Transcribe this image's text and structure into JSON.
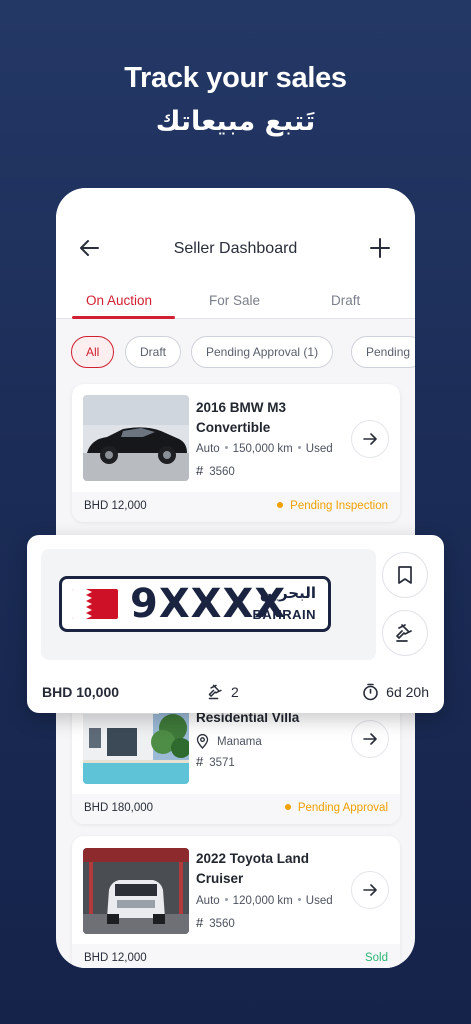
{
  "promo": {
    "title": "Track your sales",
    "subtitle_ar": "تَتبع مبيعاتك"
  },
  "header": {
    "title": "Seller Dashboard",
    "back_icon": "arrow-left-icon",
    "add_icon": "plus-icon"
  },
  "tabs": [
    {
      "label": "On Auction",
      "active": true
    },
    {
      "label": "For Sale",
      "active": false
    },
    {
      "label": "Draft",
      "active": false
    }
  ],
  "filters": [
    {
      "label": "All",
      "active": true
    },
    {
      "label": "Draft",
      "active": false
    },
    {
      "label": "Pending Approval (1)",
      "active": false
    },
    {
      "label": "Pending",
      "active": false
    }
  ],
  "listings": [
    {
      "title": "2016 BMW M3 Convertible",
      "transmission": "Auto",
      "mileage": "150,000 km",
      "condition": "Used",
      "id": "3560",
      "price": "BHD 12,000",
      "status": "Pending Inspection"
    },
    {
      "title": "Residential Villa",
      "location": "Manama",
      "id": "3571",
      "price": "BHD 180,000",
      "status": "Pending Approval"
    },
    {
      "title": "2022 Toyota Land Cruiser",
      "transmission": "Auto",
      "mileage": "120,000 km",
      "condition": "Used",
      "id": "3560",
      "price": "BHD 12,000",
      "status": "Sold"
    }
  ],
  "plate": {
    "number": "9XXXX",
    "country_ar": "البحرين",
    "country_en": "BAHRAIN",
    "price": "BHD 10,000",
    "bids": "2",
    "time_left": "6d 20h",
    "flag_colors": {
      "red": "#ce1126",
      "white": "#ffffff"
    }
  },
  "colors": {
    "accent": "#d12031",
    "pending": "#f0a000",
    "sold": "#2bb673",
    "background": "#1b2c56"
  }
}
